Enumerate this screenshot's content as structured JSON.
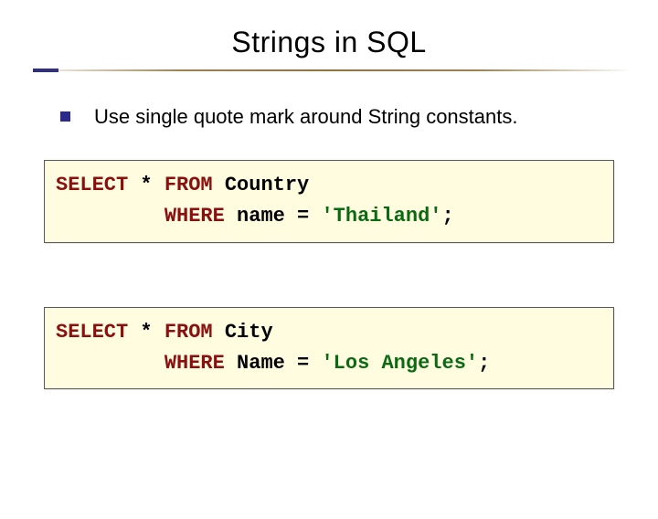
{
  "title": "Strings in SQL",
  "bullet": "Use single quote mark around String constants.",
  "code1": {
    "l1_kw1": "SELECT",
    "l1_p1": " * ",
    "l1_kw2": "FROM",
    "l1_p2": " Country",
    "l2_pad": "         ",
    "l2_kw": "WHERE",
    "l2_p1": " name = ",
    "l2_lit": "'Thailand'",
    "l2_p2": ";"
  },
  "code2": {
    "l1_kw1": "SELECT",
    "l1_p1": " * ",
    "l1_kw2": "FROM",
    "l1_p2": " City",
    "l2_pad": "         ",
    "l2_kw": "WHERE",
    "l2_p1": " Name = ",
    "l2_lit": "'Los Angeles'",
    "l2_p2": ";"
  }
}
